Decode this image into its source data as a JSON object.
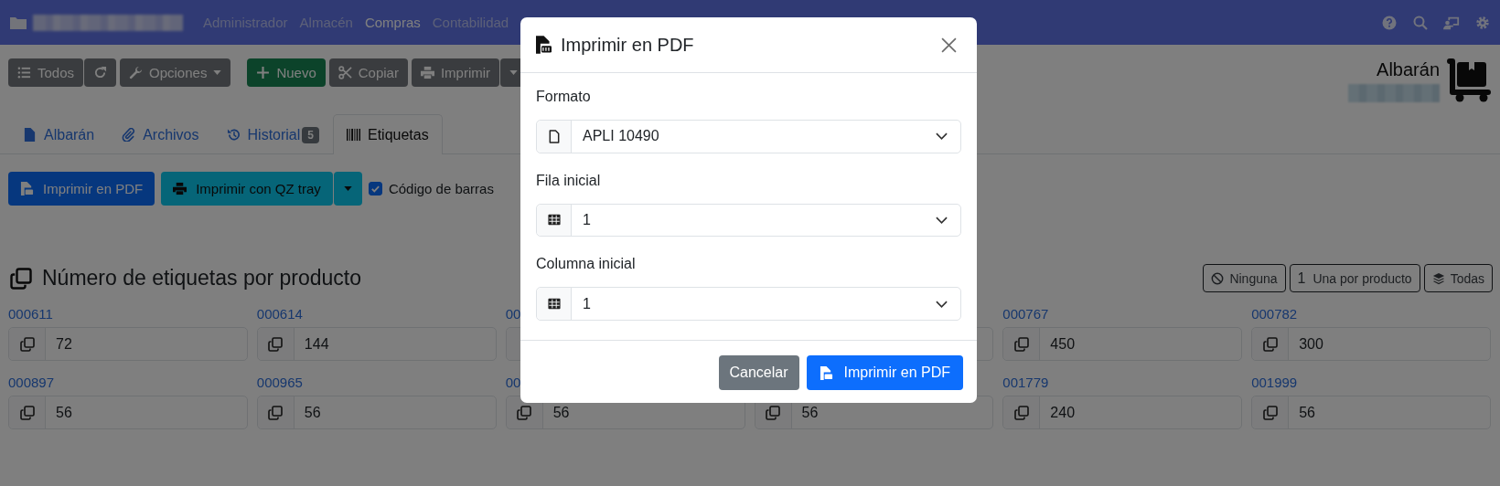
{
  "navbar": {
    "menu": [
      {
        "label": "Administrador",
        "selected": false
      },
      {
        "label": "Almacén",
        "selected": false
      },
      {
        "label": "Compras",
        "selected": true
      },
      {
        "label": "Contabilidad",
        "selected": false
      }
    ]
  },
  "toolbar": [
    {
      "label": "Todos",
      "kind": "list"
    },
    {
      "label": "Opciones",
      "kind": "options"
    },
    {
      "label": "Nuevo",
      "kind": "new"
    },
    {
      "label": "Copiar",
      "kind": "copy"
    },
    {
      "label": "Imprimir",
      "kind": "print"
    }
  ],
  "document": {
    "title": "Albarán"
  },
  "tabs": [
    {
      "label": "Albarán",
      "kind": "file",
      "selected": false
    },
    {
      "label": "Archivos",
      "kind": "clip",
      "selected": false
    },
    {
      "label": "Historial",
      "kind": "history",
      "badge": "5",
      "selected": false
    },
    {
      "label": "Etiquetas",
      "kind": "barcode",
      "selected": true
    }
  ],
  "actions": {
    "pdf_button": "Imprimir en PDF",
    "qz_button": "Imprimir con QZ tray",
    "barcode_checkbox": {
      "label": "Código de barras",
      "checked": true
    }
  },
  "section": {
    "title": "Número de etiquetas por producto",
    "buttons": [
      {
        "label": "Ninguna",
        "kind": "none"
      },
      {
        "label": "Una por producto",
        "kind": "one",
        "prefix": "1"
      },
      {
        "label": "Todas",
        "kind": "all"
      }
    ]
  },
  "products": [
    {
      "code": "000611",
      "quantity": "72"
    },
    {
      "code": "000614",
      "quantity": "144"
    },
    {
      "code": "00"
    },
    {
      "kind": "covered"
    },
    {
      "code": "000767",
      "quantity": "450"
    },
    {
      "code": "000782",
      "quantity": "300"
    },
    {
      "code": "000897",
      "quantity": "56"
    },
    {
      "code": "000965",
      "quantity": "56"
    },
    {
      "code": "00",
      "quantity": "56"
    },
    {
      "quantity": "56"
    },
    {
      "code": "001779",
      "quantity": "240"
    },
    {
      "code": "001999",
      "quantity": "56"
    }
  ],
  "modal": {
    "title": "Imprimir en PDF",
    "fields": [
      {
        "label": "Formato",
        "value": "APLI 10490",
        "kind": "file"
      },
      {
        "label": "Fila inicial",
        "value": "1",
        "kind": "table"
      },
      {
        "label": "Columna inicial",
        "value": "1",
        "kind": "table"
      }
    ],
    "buttons": [
      {
        "label": "Cancelar",
        "kind": "secondary"
      },
      {
        "label": "Imprimir en PDF",
        "kind": "primary"
      }
    ]
  }
}
